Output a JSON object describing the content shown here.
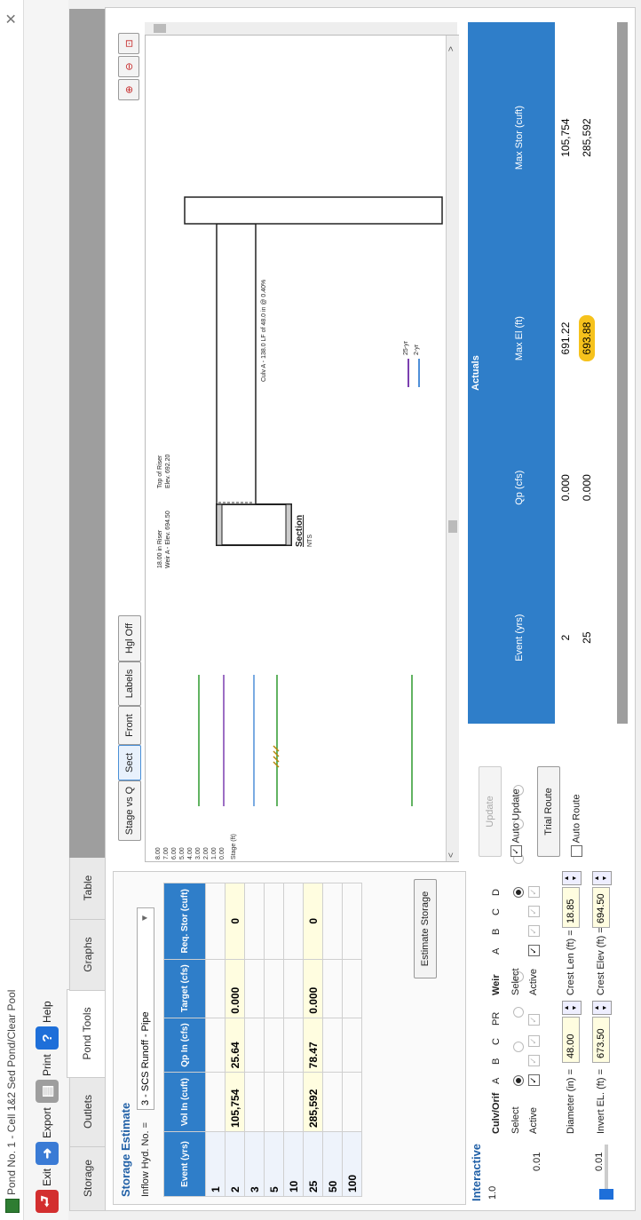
{
  "window": {
    "title": "Pond No. 1 - Cell 1&2 Sed Pond/Clear Pool"
  },
  "toolbar": {
    "exit": "Exit",
    "export": "Export",
    "print": "Print",
    "help": "Help"
  },
  "tabs": [
    "Storage",
    "Outlets",
    "Pond Tools",
    "Graphs",
    "Table"
  ],
  "storage_estimate": {
    "title": "Storage Estimate",
    "inflow_label": "Inflow Hyd. No. =",
    "inflow_value": "3 - SCS Runoff - Pipe",
    "headers": [
      "Event (yrs)",
      "Vol In (cuft)",
      "Qp In (cfs)",
      "Target (cfs)",
      "Req. Stor (cuft)"
    ],
    "rows": [
      {
        "event": "1",
        "vol": "",
        "qp": "",
        "target": "",
        "req": ""
      },
      {
        "event": "2",
        "vol": "105,754",
        "qp": "25.64",
        "target": "0.000",
        "req": "0"
      },
      {
        "event": "3",
        "vol": "",
        "qp": "",
        "target": "",
        "req": ""
      },
      {
        "event": "5",
        "vol": "",
        "qp": "",
        "target": "",
        "req": ""
      },
      {
        "event": "10",
        "vol": "",
        "qp": "",
        "target": "",
        "req": ""
      },
      {
        "event": "25",
        "vol": "285,592",
        "qp": "78.47",
        "target": "0.000",
        "req": "0"
      },
      {
        "event": "50",
        "vol": "",
        "qp": "",
        "target": "",
        "req": ""
      },
      {
        "event": "100",
        "vol": "",
        "qp": "",
        "target": "",
        "req": ""
      }
    ],
    "estimate_button": "Estimate Storage"
  },
  "graph": {
    "buttons": [
      "Stage vs Q",
      "Sect",
      "Front",
      "Labels",
      "Hgl Off"
    ],
    "active_button": "Sect",
    "stage_ticks": [
      "8.00",
      "7.00",
      "6.00",
      "5.00",
      "4.00",
      "3.00",
      "2.00",
      "1.00",
      "0.00"
    ],
    "stage_label": "Stage (ft)",
    "riser_label": "18.00 in Riser",
    "weir_label": "Weir A - Elev. 694.50",
    "topbound_label": "Top of Riser",
    "topbound_elev": "Elev. 692.20",
    "culvert_label": "Culv A - 138.0 LF of 48.0 in @ 0.40%",
    "section_label": "Section",
    "section_sub": "NTS",
    "legend": [
      "25-yr",
      "2-yr"
    ],
    "colors": {
      "green": "#2e9a2e",
      "purple": "#7b3fb0",
      "blue": "#4f8fd8"
    }
  },
  "interactive": {
    "title": "Interactive",
    "slider_top": "1.0",
    "slider_mid": "0.01",
    "slider_bot": "0.01",
    "culvert_group": "Culv/Orif",
    "weir_group": "Weir",
    "select_label": "Select",
    "active_label": "Active",
    "culv_cols": [
      "A",
      "B",
      "C",
      "PR"
    ],
    "weir_cols": [
      "A",
      "B",
      "C",
      "D"
    ],
    "diameter_label": "Diameter (in) =",
    "diameter_value": "48.00",
    "invert_label": "Invert EL. (ft) =",
    "invert_value": "673.50",
    "crest_len_label": "Crest Len (ft) =",
    "crest_len_value": "18.85",
    "crest_elev_label": "Crest Elev (ft) =",
    "crest_elev_value": "694.50",
    "update": "Update",
    "auto_update": "Auto Update",
    "trial_route": "Trial Route",
    "auto_route": "Auto Route"
  },
  "results": {
    "actuals_label": "Actuals",
    "headers": [
      "Event (yrs)",
      "Qp (cfs)",
      "Max El (ft)",
      "Max Stor (cuft)"
    ],
    "rows": [
      {
        "event": "2",
        "qp": "0.000",
        "maxel": "691.22",
        "maxstor": "105,754"
      },
      {
        "event": "25",
        "qp": "0.000",
        "maxel": "693.88",
        "maxstor": "285,592"
      }
    ],
    "highlight_color": "#f6c21c"
  }
}
